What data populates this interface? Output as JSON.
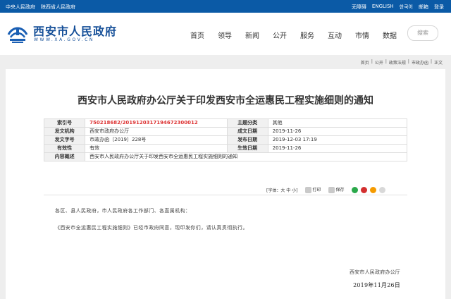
{
  "topbar": {
    "left": [
      "中央人民政府",
      "陕西省人民政府"
    ],
    "right": [
      "无障碍",
      "ENGLISH",
      "한국어",
      "邮箱",
      "登录"
    ]
  },
  "header": {
    "site_name": "西安市人民政府",
    "site_domain": "WWW.XA.GOV.CN",
    "nav": [
      "首页",
      "领导",
      "新闻",
      "公开",
      "服务",
      "互动",
      "市情",
      "数据"
    ],
    "search_placeholder": "搜索"
  },
  "breadcrumb": [
    "首页",
    "|",
    "公开",
    "|",
    "政策法规",
    "|",
    "市政办函",
    "|",
    "正文"
  ],
  "article": {
    "title": "西安市人民政府办公厅关于印发西安市全运惠民工程实施细则的通知",
    "meta": {
      "index_no_label": "索引号",
      "index_no": "750218682/2019120317194672300012",
      "topic_label": "主题分类",
      "topic": "其他",
      "issuer_label": "发文机构",
      "issuer": "西安市政府办公厅",
      "created_label": "成文日期",
      "created": "2019-11-26",
      "doc_no_label": "发文字号",
      "doc_no": "市政办函〔2019〕228号",
      "published_label": "发布日期",
      "published": "2019-12-03 17:19",
      "valid_label": "有效性",
      "valid": "有效",
      "effective_label": "生效日期",
      "effective": "2019-11-26",
      "summary_label": "内容概述",
      "summary": "西安市人民政府办公厅关于印发西安市全运惠民工程实施细则的通知"
    },
    "tools": {
      "font_size": "[字体：大 中 小]",
      "print": "打印",
      "save": "保存"
    },
    "body": {
      "p1": "各区、县人民政府，市人民政府各工作部门、各直属机构：",
      "p2": "《西安市全运惠民工程实施细则》已经市政府同意，现印发你们，请认真贯彻执行。"
    },
    "signature": {
      "org": "西安市人民政府办公厅",
      "date": "2019年11月26日"
    }
  }
}
